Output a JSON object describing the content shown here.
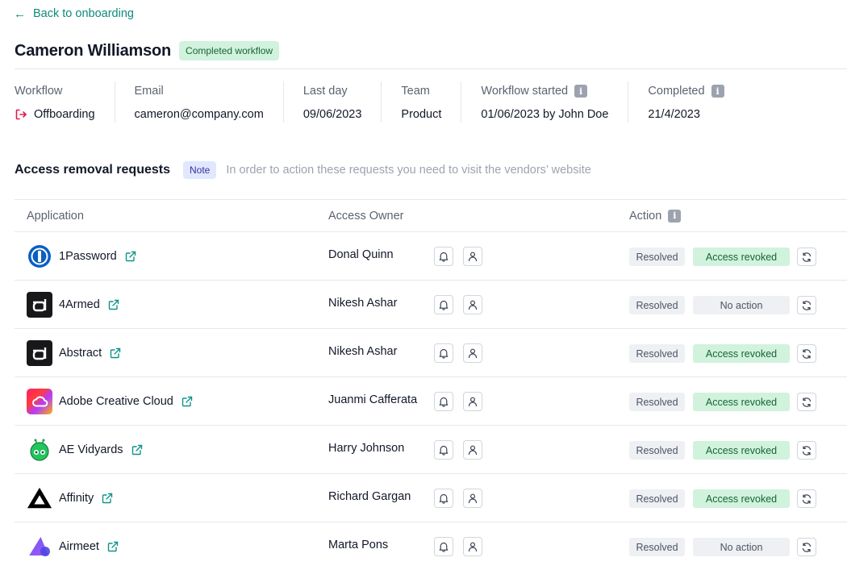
{
  "back_link": {
    "label": "Back to onboarding"
  },
  "header": {
    "title": "Cameron Williamson",
    "status_badge": "Completed workflow"
  },
  "meta": [
    {
      "key": "workflow",
      "label": "Workflow",
      "value": "Offboarding",
      "info": false
    },
    {
      "key": "email",
      "label": "Email",
      "value": "cameron@company.com",
      "info": false
    },
    {
      "key": "last_day",
      "label": "Last day",
      "value": "09/06/2023",
      "info": false
    },
    {
      "key": "team",
      "label": "Team",
      "value": "Product",
      "info": false
    },
    {
      "key": "workflow_started",
      "label": "Workflow started",
      "value": "01/06/2023 by John Doe",
      "info": true
    },
    {
      "key": "completed",
      "label": "Completed",
      "value": "21/4/2023",
      "info": true
    }
  ],
  "section": {
    "title": "Access removal requests",
    "note_badge": "Note",
    "note_text": "In order to action these requests you need to visit the vendors’ website"
  },
  "table": {
    "columns": {
      "application": "Application",
      "access_owner": "Access Owner",
      "action": "Action"
    },
    "rows": [
      {
        "app": "1Password",
        "logo": "onepassword",
        "owner": "Donal Quinn",
        "resolved": "Resolved",
        "state": "Access revoked",
        "state_type": "revoked"
      },
      {
        "app": "4Armed",
        "logo": "fourarmed",
        "owner": "Nikesh Ashar",
        "resolved": "Resolved",
        "state": "No action",
        "state_type": "none"
      },
      {
        "app": "Abstract",
        "logo": "abstract",
        "owner": "Nikesh Ashar",
        "resolved": "Resolved",
        "state": "Access revoked",
        "state_type": "revoked"
      },
      {
        "app": "Adobe Creative Cloud",
        "logo": "adobe-cc",
        "owner": "Juanmi Cafferata",
        "resolved": "Resolved",
        "state": "Access revoked",
        "state_type": "revoked"
      },
      {
        "app": "AE Vidyards",
        "logo": "ae-vidyards",
        "owner": "Harry Johnson",
        "resolved": "Resolved",
        "state": "Access revoked",
        "state_type": "revoked"
      },
      {
        "app": "Affinity",
        "logo": "affinity",
        "owner": "Richard Gargan",
        "resolved": "Resolved",
        "state": "Access revoked",
        "state_type": "revoked"
      },
      {
        "app": "Airmeet",
        "logo": "airmeet",
        "owner": "Marta Pons",
        "resolved": "Resolved",
        "state": "No action",
        "state_type": "none"
      }
    ]
  },
  "colors": {
    "accent_teal": "#0d8a7c",
    "success_bg": "#d1f2dd",
    "success_text": "#166534",
    "note_bg": "#e0e7ff",
    "exit_red": "#e11d48"
  }
}
